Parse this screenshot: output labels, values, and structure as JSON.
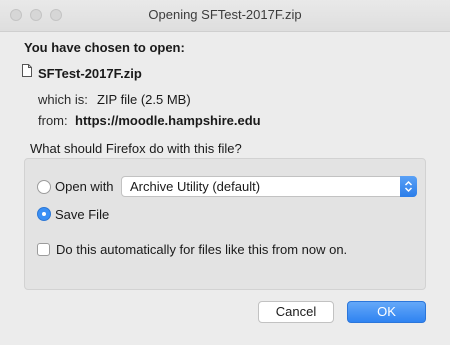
{
  "window": {
    "title": "Opening SFTest-2017F.zip"
  },
  "dialog": {
    "heading": "You have chosen to open:",
    "filename": "SFTest-2017F.zip",
    "which_is_label": "which is:",
    "which_is_value": "ZIP file (2.5 MB)",
    "from_label": "from:",
    "from_value": "https://moodle.hampshire.edu",
    "question": "What should Firefox do with this file?"
  },
  "options": {
    "open_with_label": "Open with",
    "open_with_app": "Archive Utility (default)",
    "save_file_label": "Save File",
    "selected": "save_file",
    "auto_label": "Do this automatically for files like this from now on.",
    "auto_checked": false
  },
  "buttons": {
    "cancel": "Cancel",
    "ok": "OK"
  },
  "colors": {
    "accent": "#2f83f1",
    "background": "#ececec"
  },
  "icons": {
    "file": "file-icon",
    "select_arrows": "chevron-updown-icon"
  }
}
